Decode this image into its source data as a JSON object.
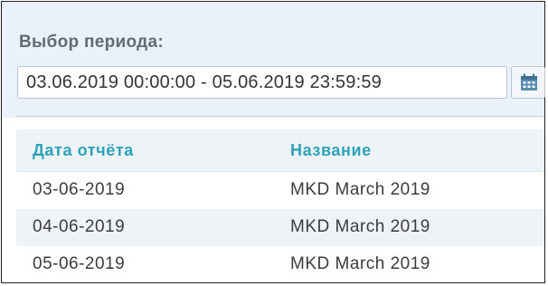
{
  "period": {
    "label": "Выбор периода:",
    "range_value": "03.06.2019 00:00:00 - 05.06.2019 23:59:59",
    "calendar_icon": "calendar-icon"
  },
  "table": {
    "headers": [
      "Дата отчёта",
      "Название"
    ],
    "rows": [
      [
        "03-06-2019",
        "MKD March 2019"
      ],
      [
        "04-06-2019",
        "MKD March 2019"
      ],
      [
        "05-06-2019",
        "MKD March 2019"
      ]
    ]
  },
  "colors": {
    "header_text": "#2ea2b8",
    "panel_bg": "#eaf1f8",
    "row_alt_bg": "#eef3f8"
  }
}
